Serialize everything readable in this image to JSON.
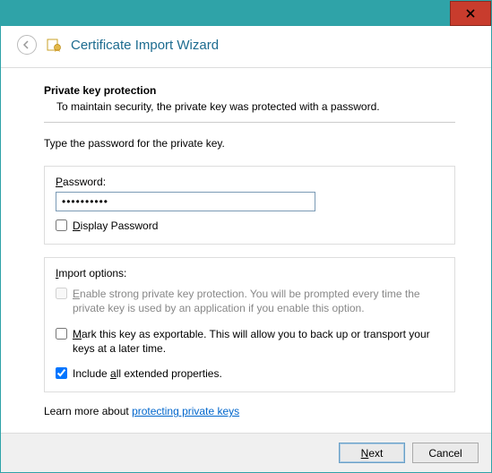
{
  "window": {
    "title": "Certificate Import Wizard"
  },
  "header": {
    "section_title": "Private key protection",
    "section_desc": "To maintain security, the private key was protected with a password."
  },
  "body": {
    "instruction": "Type the password for the private key.",
    "password_label_pre": "",
    "password_label_u": "P",
    "password_label_post": "assword:",
    "password_value": "••••••••••",
    "display_pw_pre": "",
    "display_pw_u": "D",
    "display_pw_post": "isplay Password",
    "display_pw_checked": false
  },
  "import": {
    "legend_pre": "",
    "legend_u": "I",
    "legend_post": "mport options:",
    "opt1_pre": "",
    "opt1_u": "E",
    "opt1_post": "nable strong private key protection. You will be prompted every time the private key is used by an application if you enable this option.",
    "opt1_checked": false,
    "opt1_disabled": true,
    "opt2_pre": "",
    "opt2_u": "M",
    "opt2_post": "ark this key as exportable. This will allow you to back up or transport your keys at a later time.",
    "opt2_checked": false,
    "opt3_pre": "Include ",
    "opt3_u": "a",
    "opt3_post": "ll extended properties.",
    "opt3_checked": true
  },
  "learn": {
    "prefix": "Learn more about ",
    "link": "protecting private keys"
  },
  "footer": {
    "next_u": "N",
    "next_post": "ext",
    "cancel": "Cancel"
  }
}
